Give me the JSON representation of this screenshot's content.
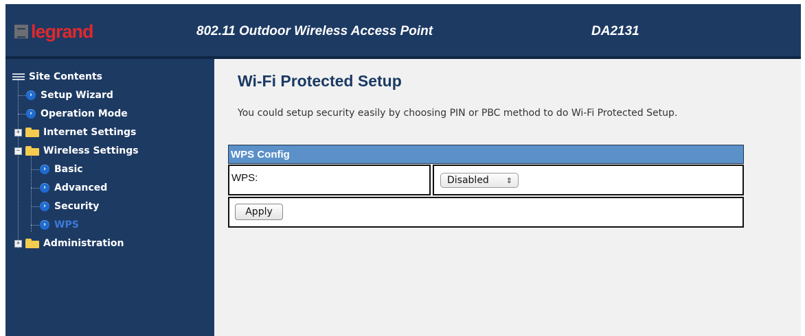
{
  "header": {
    "logo_text": "legrand",
    "product_title": "802.11 Outdoor Wireless Access Point",
    "model": "DA2131"
  },
  "sidebar": {
    "root_label": "Site Contents",
    "items": [
      {
        "label": "Setup Wizard",
        "type": "page",
        "icon": "arrow-icon"
      },
      {
        "label": "Operation Mode",
        "type": "page",
        "icon": "arrow-icon"
      },
      {
        "label": "Internet Settings",
        "type": "folder",
        "expanded": false,
        "icon": "folder-icon"
      },
      {
        "label": "Wireless Settings",
        "type": "folder",
        "expanded": true,
        "icon": "folder-open-icon"
      },
      {
        "label": "Basic",
        "type": "page",
        "icon": "arrow-icon"
      },
      {
        "label": "Advanced",
        "type": "page",
        "icon": "arrow-icon"
      },
      {
        "label": "Security",
        "type": "page",
        "icon": "arrow-icon"
      },
      {
        "label": "WPS",
        "type": "page",
        "active": true,
        "icon": "arrow-icon"
      },
      {
        "label": "Administration",
        "type": "folder",
        "expanded": false,
        "icon": "folder-icon"
      }
    ]
  },
  "main": {
    "title": "Wi-Fi Protected Setup",
    "description": "You could setup security easily by choosing PIN or PBC method to do Wi-Fi Protected Setup.",
    "config_header": "WPS Config",
    "wps_label": "WPS:",
    "wps_value": "Disabled",
    "apply_label": "Apply"
  },
  "colors": {
    "navy": "#1d3a63",
    "header_bar": "#5b90c8",
    "active_link": "#3c79d9",
    "logo_red": "#e0282c"
  }
}
